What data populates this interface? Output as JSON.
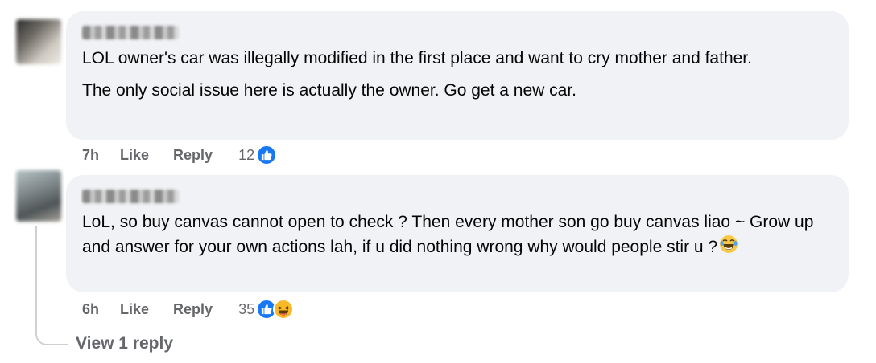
{
  "comments": [
    {
      "author": "",
      "paragraphs": [
        "LOL owner's car was illegally modified in the first place and want to cry mother and father.",
        "The only social issue here is actually the owner. Go get a new car."
      ],
      "time": "7h",
      "like_label": "Like",
      "reply_label": "Reply",
      "reaction_count": "12",
      "reactions": [
        "like-icon"
      ]
    },
    {
      "author": "",
      "paragraphs": [
        "LoL, so buy canvas cannot open to check ? Then every mother son go buy canvas liao ~ Grow up and answer for your own actions lah, if u did nothing wrong why would people stir u ?"
      ],
      "inline_emoji": "crying-laughing-emoji",
      "time": "6h",
      "like_label": "Like",
      "reply_label": "Reply",
      "reaction_count": "35",
      "reactions": [
        "like-icon",
        "haha-icon"
      ]
    }
  ],
  "view_replies_label": "View 1 reply",
  "colors": {
    "bubble": "#f0f2f5",
    "meta_text": "#65676b",
    "like_blue": "#1877f2",
    "haha_yellow": "#f7b928",
    "thread_line": "#ced0d4"
  }
}
